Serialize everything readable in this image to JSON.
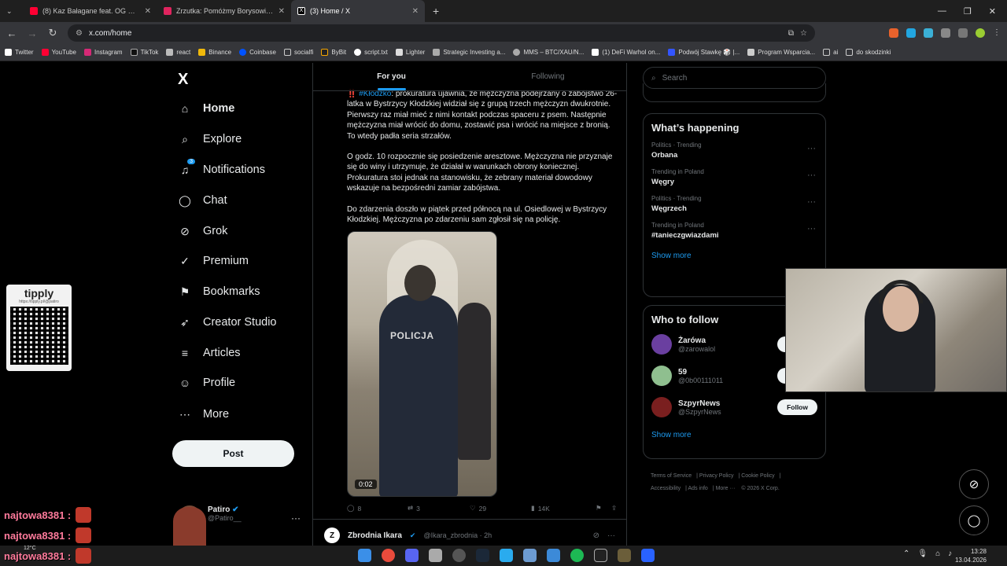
{
  "browser": {
    "tabs": [
      {
        "title": "(8) Kaz Bałagane feat. OG Olgie",
        "color": "#ff0033"
      },
      {
        "title": "Zrzutka: Pomóżmy Borysowi - w",
        "color": "#e0245e"
      },
      {
        "title": "(3) Home / X",
        "color": "#000000"
      }
    ],
    "url": "x.com/home",
    "bookmarks": [
      "Twitter",
      "YouTube",
      "Instagram",
      "TikTok",
      "react",
      "Binance",
      "Coinbase",
      "socialfi",
      "ByBit",
      "script.txt",
      "Lighter",
      "Strategic Investing a...",
      "MMS – BTC/XAU/N...",
      "(1) DeFi Warhol on...",
      "Podwój Stawkę 🎲 |...",
      "Program Wsparcia...",
      "ai",
      "do skodzinki"
    ]
  },
  "sidebar": {
    "logo": "X",
    "items": [
      {
        "label": "Home",
        "icon": "home-icon",
        "glyph": "⌂"
      },
      {
        "label": "Explore",
        "icon": "search-icon",
        "glyph": "⌕"
      },
      {
        "label": "Notifications",
        "icon": "bell-icon",
        "glyph": "🔔"
      },
      {
        "label": "Chat",
        "icon": "chat-icon",
        "glyph": "◯"
      },
      {
        "label": "Grok",
        "icon": "grok-icon",
        "glyph": "⊘"
      },
      {
        "label": "Premium",
        "icon": "premium-icon",
        "glyph": "✓"
      },
      {
        "label": "Bookmarks",
        "icon": "bookmark-icon",
        "glyph": "⚑"
      },
      {
        "label": "Creator Studio",
        "icon": "rocket-icon",
        "glyph": "➶"
      },
      {
        "label": "Articles",
        "icon": "articles-icon",
        "glyph": "≡"
      },
      {
        "label": "Profile",
        "icon": "profile-icon",
        "glyph": "👤"
      },
      {
        "label": "More",
        "icon": "more-icon",
        "glyph": "⋯"
      }
    ],
    "notification_badge": "3",
    "post_label": "Post",
    "profile": {
      "name": "Patiro",
      "handle": "@Patiro__"
    }
  },
  "feed": {
    "tabs": [
      "For you",
      "Following"
    ],
    "tweet": {
      "hashtag": "#Kłodzko",
      "p1": ": prokuratura ujawnia, że mężczyzna podejrzany o zabójstwo 26-latka w Bystrzycy Kłodzkiej widział się z grupą trzech mężczyzn dwukrotnie. Pierwszy raz miał mieć z nimi kontakt podczas spaceru z psem. Następnie mężczyzna miał wrócić do domu, zostawić psa i wrócić na miejsce z bronią. To wtedy padła seria strzałów.",
      "p2": "O godz. 10 rozpocznie się posiedzenie aresztowe. Mężczyzna nie przyznaje się do winy i utrzymuje, że działał w warunkach obrony koniecznej. Prokuratura stoi jednak na stanowisku, że zebrany materiał dowodowy wskazuje na bezpośredni zamiar zabójstwa.",
      "p3": "Do zdarzenia doszło w piątek przed północą na ul. Osiedlowej w Bystrzycy Kłodzkiej. Mężczyzna po zdarzeniu sam zgłosił się na policję.",
      "video_text": "POLICJA",
      "video_duration": "0:02",
      "replies": "8",
      "reposts": "3",
      "likes": "29",
      "views": "14K"
    },
    "next_tweet": {
      "name": "Zbrodnia Ikara",
      "handle": "@Ikara_zbrodnia · 2h"
    }
  },
  "right": {
    "search_placeholder": "Search",
    "happening_title": "What’s happening",
    "trends": [
      {
        "meta": "Politics · Trending",
        "name": "Orbana"
      },
      {
        "meta": "Trending in Poland",
        "name": "Węgry"
      },
      {
        "meta": "Politics · Trending",
        "name": "Węgrzech"
      },
      {
        "meta": "Trending in Poland",
        "name": "#tanieczgwiazdami"
      }
    ],
    "show_more": "Show more",
    "wtf_title": "Who to follow",
    "follow": [
      {
        "name": "Żarówa",
        "handle": "@zarowalol",
        "color": "#6a3fa0"
      },
      {
        "name": "59",
        "handle": "@0b00111011",
        "color": "#8fbf8f"
      },
      {
        "name": "SzpyrNews",
        "handle": "@SzpyrNews",
        "color": "#7a1f1f"
      }
    ],
    "follow_label": "Follow",
    "footer": [
      "Terms of Service",
      "Privacy Policy",
      "Cookie Policy",
      "Accessibility",
      "Ads info",
      "More ···",
      "© 2026 X Corp."
    ]
  },
  "overlay": {
    "tipply_title": "tipply",
    "tipply_url": "https://tipply.pl/@patiro",
    "chat": [
      "najtowa8381 :",
      "najtowa8381 :",
      "najtowa8381 :"
    ]
  },
  "taskbar": {
    "weather": "12°C",
    "time": "13:28",
    "date": "13.04.2026"
  }
}
